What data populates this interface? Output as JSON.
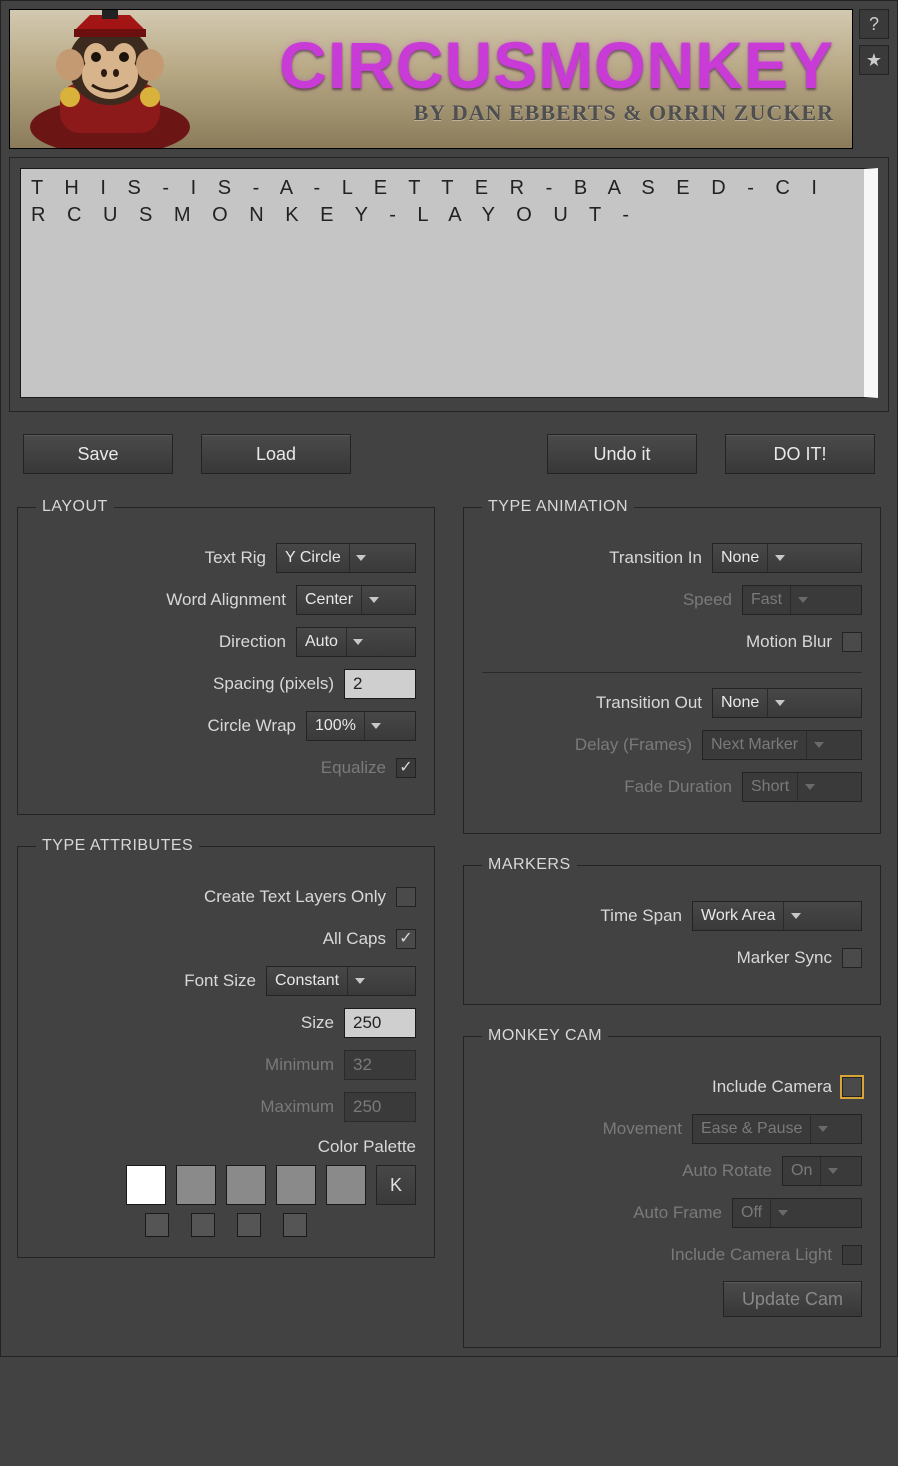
{
  "banner": {
    "title": "CIRCUSMONKEY",
    "subtitle": "BY DAN EBBERTS & ORRIN ZUCKER"
  },
  "help_icon": "?",
  "star_icon": "★",
  "text_input": "T H I S - I S - A - L E T T E R - B A S E D - C I R C U S M O N K E Y - L A Y O U T -",
  "buttons": {
    "save": "Save",
    "load": "Load",
    "undo": "Undo it",
    "doit": "DO IT!"
  },
  "layout": {
    "legend": "LAYOUT",
    "text_rig_label": "Text Rig",
    "text_rig": "Y Circle",
    "word_alignment_label": "Word Alignment",
    "word_alignment": "Center",
    "direction_label": "Direction",
    "direction": "Auto",
    "spacing_label": "Spacing (pixels)",
    "spacing": "2",
    "circle_wrap_label": "Circle Wrap",
    "circle_wrap": "100%",
    "equalize_label": "Equalize",
    "equalize_checked": true
  },
  "type_attributes": {
    "legend": "TYPE ATTRIBUTES",
    "create_text_layers_label": "Create Text Layers Only",
    "create_text_layers_checked": false,
    "all_caps_label": "All Caps",
    "all_caps_checked": true,
    "font_size_label": "Font Size",
    "font_size_mode": "Constant",
    "size_label": "Size",
    "size": "250",
    "minimum_label": "Minimum",
    "minimum": "32",
    "maximum_label": "Maximum",
    "maximum": "250",
    "color_palette_label": "Color Palette",
    "k_label": "K",
    "swatches": [
      "#ffffff",
      "#8a8a8a",
      "#8a8a8a",
      "#8a8a8a",
      "#8a8a8a"
    ],
    "swatches_sm": [
      "#555",
      "#555",
      "#555",
      "#555"
    ]
  },
  "type_animation": {
    "legend": "TYPE ANIMATION",
    "transition_in_label": "Transition In",
    "transition_in": "None",
    "speed_label": "Speed",
    "speed": "Fast",
    "motion_blur_label": "Motion Blur",
    "motion_blur_checked": false,
    "transition_out_label": "Transition Out",
    "transition_out": "None",
    "delay_label": "Delay (Frames)",
    "delay": "Next Marker",
    "fade_label": "Fade Duration",
    "fade": "Short"
  },
  "markers": {
    "legend": "MARKERS",
    "time_span_label": "Time Span",
    "time_span": "Work Area",
    "marker_sync_label": "Marker Sync",
    "marker_sync_checked": false
  },
  "monkey_cam": {
    "legend": "MONKEY CAM",
    "include_camera_label": "Include Camera",
    "include_camera_checked": false,
    "movement_label": "Movement",
    "movement": "Ease & Pause",
    "auto_rotate_label": "Auto Rotate",
    "auto_rotate": "On",
    "auto_frame_label": "Auto Frame",
    "auto_frame": "Off",
    "include_light_label": "Include Camera Light",
    "include_light_checked": false,
    "update_btn": "Update Cam"
  }
}
